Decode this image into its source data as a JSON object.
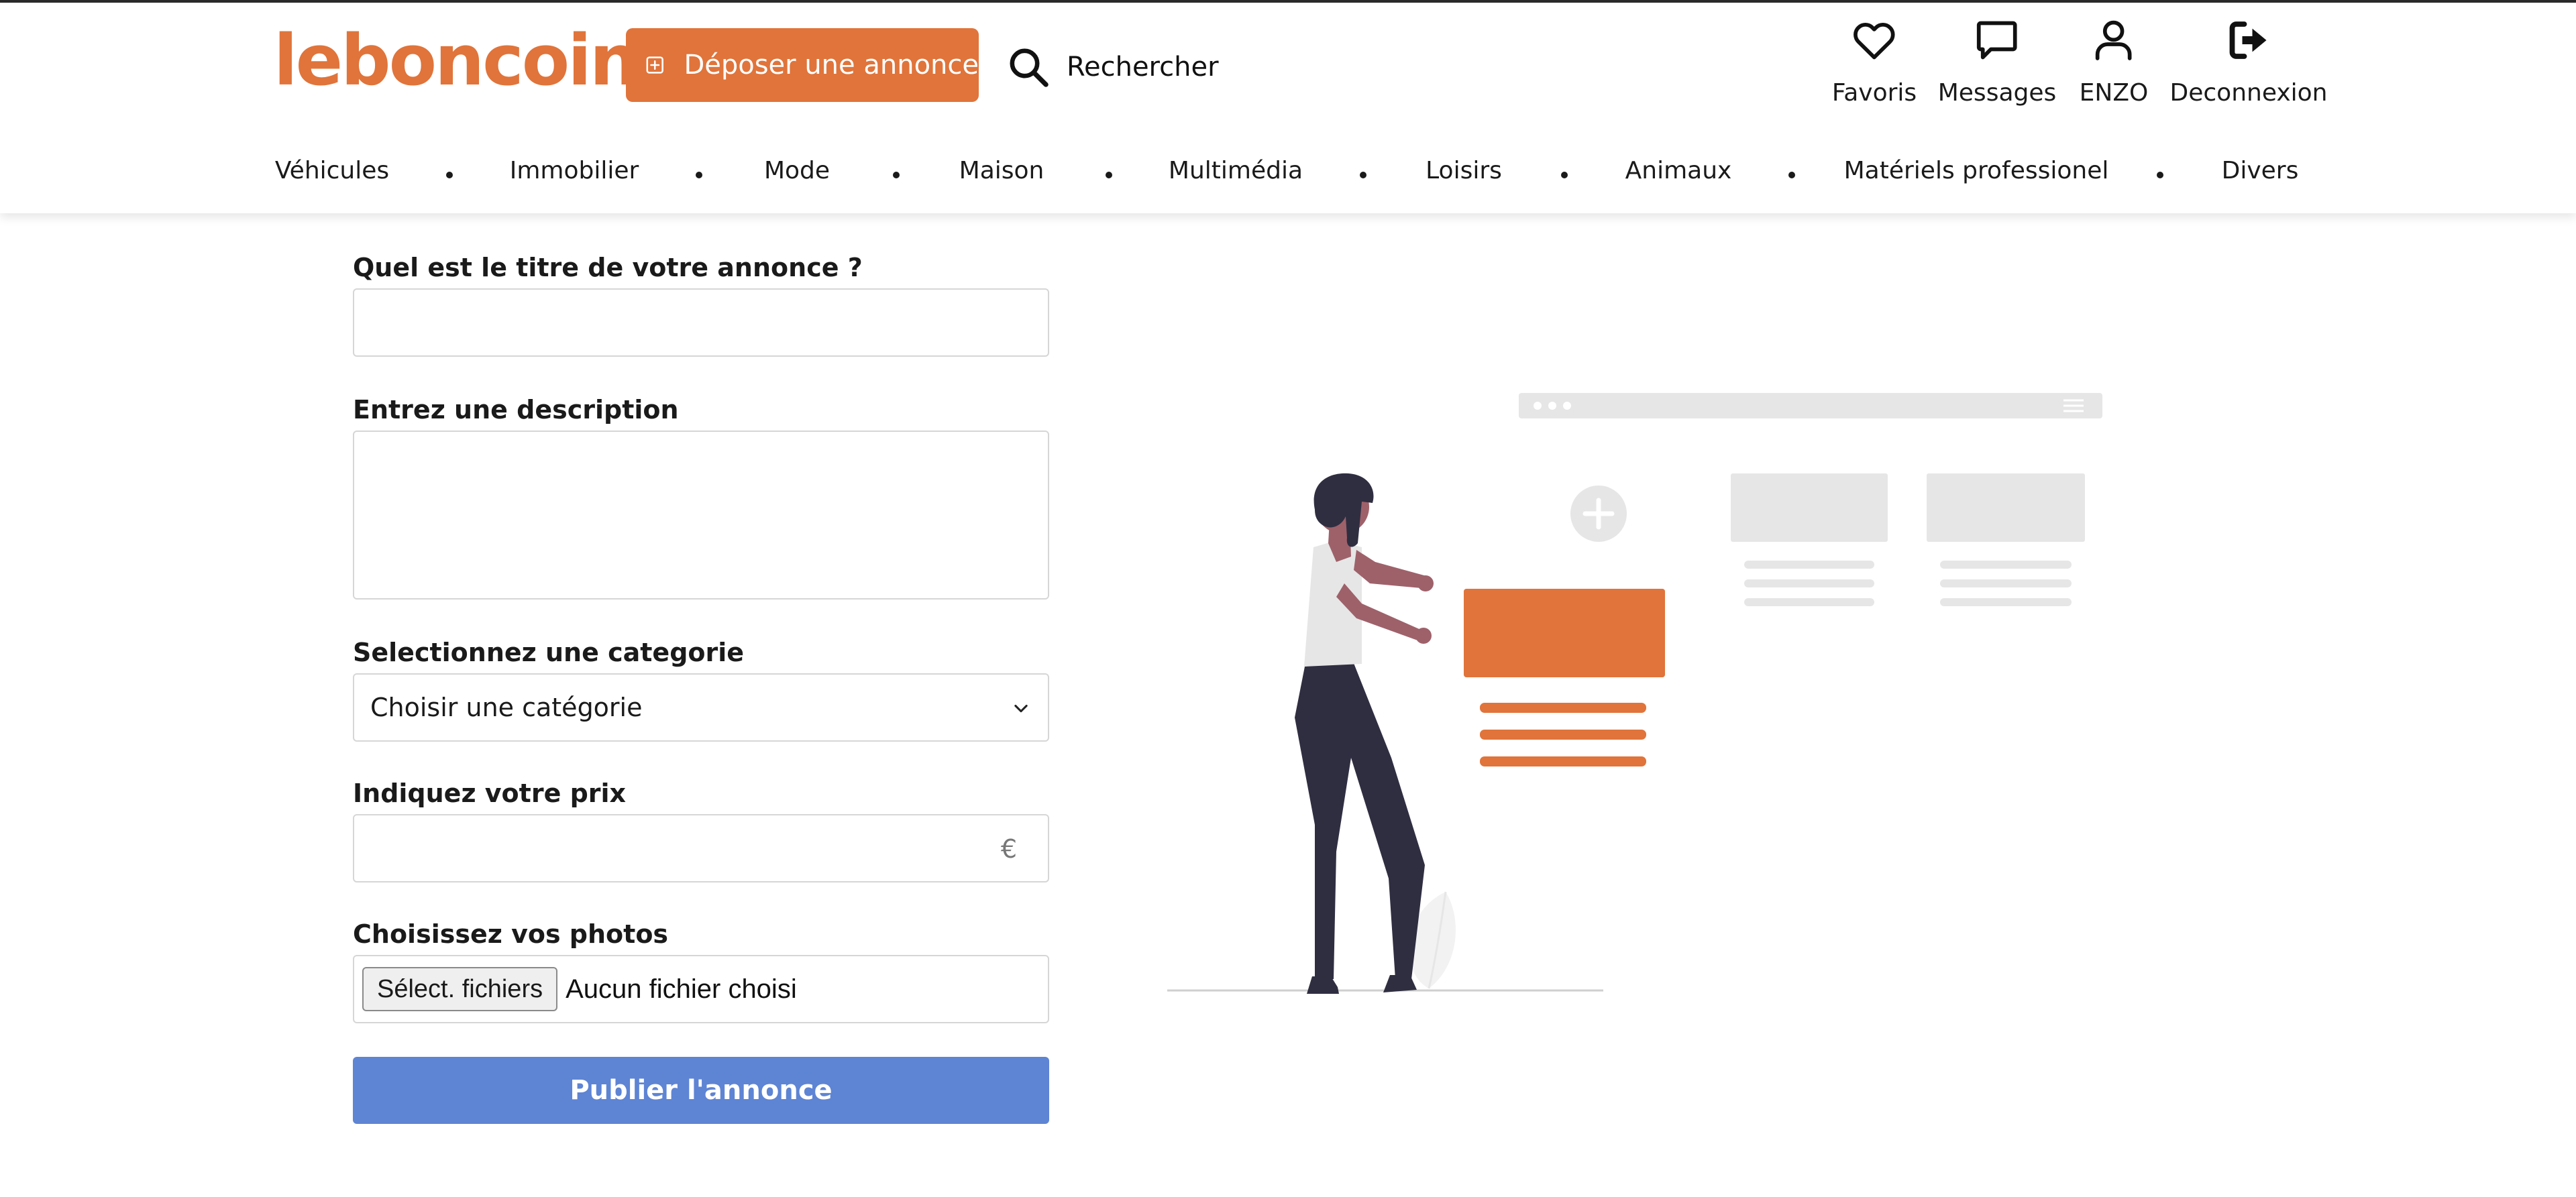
{
  "brand": {
    "logo_text": "leboncoin",
    "accent_color": "#e0743b",
    "publish_color": "#5e84d4"
  },
  "header": {
    "deposit_label": "Déposer une annonce",
    "deposit_icon": "plus-square-icon",
    "search_label": "Rechercher",
    "search_icon": "search-icon",
    "actions": [
      {
        "label": "Favoris",
        "icon": "heart-icon"
      },
      {
        "label": "Messages",
        "icon": "chat-bubble-icon"
      },
      {
        "label": "ENZO",
        "icon": "user-icon"
      },
      {
        "label": "Deconnexion",
        "icon": "logout-icon"
      }
    ]
  },
  "categories": [
    "Véhicules",
    "Immobilier",
    "Mode",
    "Maison",
    "Multimédia",
    "Loisirs",
    "Animaux",
    "Matériels professionel",
    "Divers"
  ],
  "form": {
    "title_label": "Quel est le titre de votre annonce ?",
    "title_value": "",
    "description_label": "Entrez une description",
    "description_value": "",
    "category_label": "Selectionnez une categorie",
    "category_selected": "Choisir une catégorie",
    "price_label": "Indiquez votre prix",
    "price_value": "",
    "currency_symbol": "€",
    "photos_label": "Choisissez vos photos",
    "file_button_label": "Sélect. fichiers",
    "file_status": "Aucun fichier choisi",
    "publish_label": "Publier l'annonce"
  }
}
